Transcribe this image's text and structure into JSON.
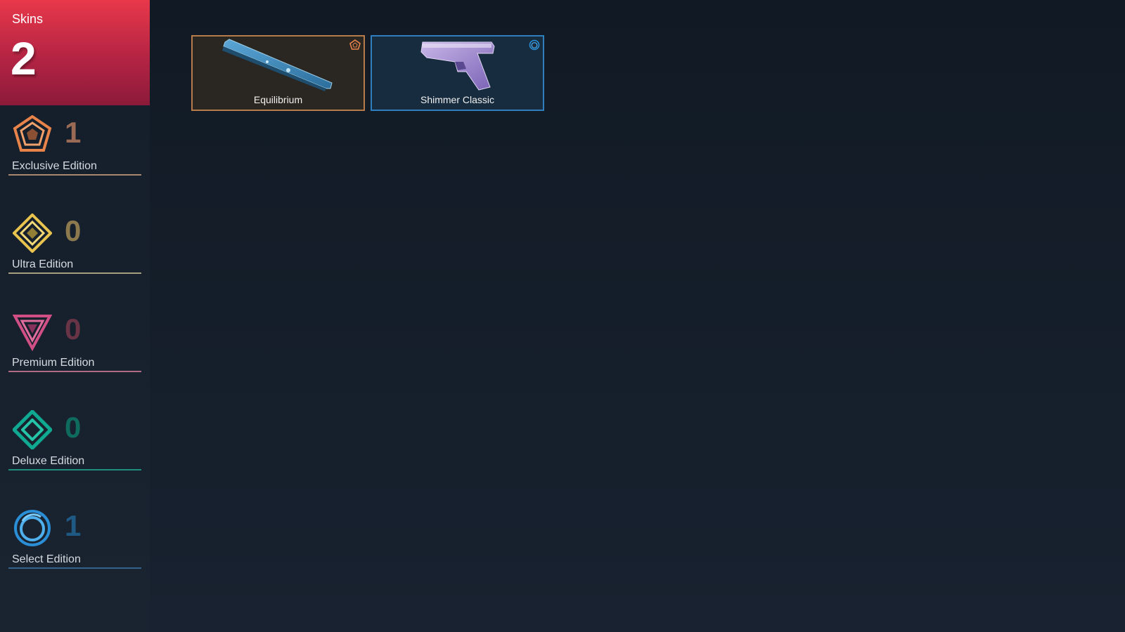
{
  "skins": {
    "title": "Skins",
    "count": "2"
  },
  "tiers": [
    {
      "label": "Exclusive Edition",
      "count": "1",
      "color": "#e8834a"
    },
    {
      "label": "Ultra Edition",
      "count": "0",
      "color": "#e8c44e"
    },
    {
      "label": "Premium Edition",
      "count": "0",
      "color": "#d24f86"
    },
    {
      "label": "Deluxe Edition",
      "count": "0",
      "color": "#0fa890"
    },
    {
      "label": "Select Edition",
      "count": "1",
      "color": "#2a8fd6"
    }
  ],
  "cards": [
    {
      "name": "Equilibrium",
      "icon": "sniper-rifle-icon",
      "tier_icon": "exclusive-icon",
      "border": "#c9824a",
      "background": "#2a2722"
    },
    {
      "name": "Shimmer Classic",
      "icon": "pistol-icon",
      "tier_icon": "select-icon",
      "border": "#2f7fbf",
      "background": "#172c3f"
    }
  ]
}
